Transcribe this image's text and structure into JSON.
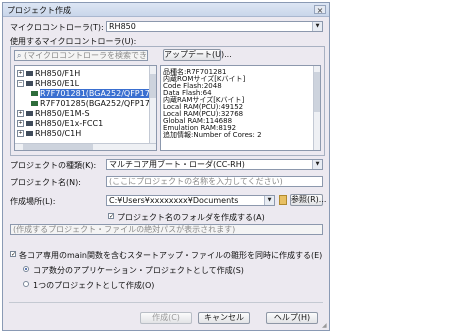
{
  "window": {
    "title": "プロジェクト作成",
    "close_icon": "×"
  },
  "microcontroller": {
    "label": "マイクロコントローラ(T):",
    "value": "RH850"
  },
  "used_mc": {
    "label": "使用するマイクロコントローラ(U):",
    "search_placeholder": "(マイクロコントローラを検索できます)",
    "update_button": "アップデート(U)..."
  },
  "tree": {
    "items": [
      {
        "label": "RH850/F1H",
        "expanded": false
      },
      {
        "label": "RH850/E1L",
        "expanded": true
      },
      {
        "label": "R7F701281(BGA252/QFP176/",
        "selected": true
      },
      {
        "label": "R7F701285(BGA252/QFP176/",
        "selected": false
      },
      {
        "label": "RH850/E1M-S",
        "expanded": false
      },
      {
        "label": "RH850/E1x-FCC1",
        "expanded": false
      },
      {
        "label": "RH850/C1H",
        "expanded": false
      }
    ]
  },
  "info": {
    "lines": [
      "品種名:R7F701281",
      "内蔵ROMサイズ[Kバイト]",
      "  Code Flash:2048",
      "  Data Flash:64",
      "内蔵RAMサイズ[Kバイト]",
      "  Local RAM(PCU):49152",
      "  Local RAM(PCU):32768",
      "  Global RAM:114688",
      "  Emulation RAM:8192",
      "追加情報:Number of Cores: 2"
    ]
  },
  "project_type": {
    "label": "プロジェクトの種類(K):",
    "value": "マルチコア用ブート・ローダ(CC-RH)"
  },
  "project_name": {
    "label": "プロジェクト名(N):",
    "placeholder": "(ここにプロジェクトの名称を入力してください)"
  },
  "location": {
    "label": "作成場所(L):",
    "value": "C:¥Users¥xxxxxxxx¥Documents",
    "browse_button": "参照(R)..."
  },
  "folder_checkbox": {
    "label": "プロジェクト名のフォルダを作成する(A)",
    "checked": true
  },
  "file_path": {
    "placeholder": "(作成するプロジェクト・ファイルの絶対パスが表示されます)"
  },
  "startup_checkbox": {
    "label": "各コア専用のmain関数を含むスタートアップ・ファイルの雛形を同時に作成する(E)",
    "checked": true
  },
  "radio": {
    "per_core": "コア数分のアプリケーション・プロジェクトとして作成(S)",
    "single": "1つのプロジェクトとして作成(O)"
  },
  "buttons": {
    "create": "作成(C)",
    "cancel": "キャンセル",
    "help": "ヘルプ(H)"
  }
}
